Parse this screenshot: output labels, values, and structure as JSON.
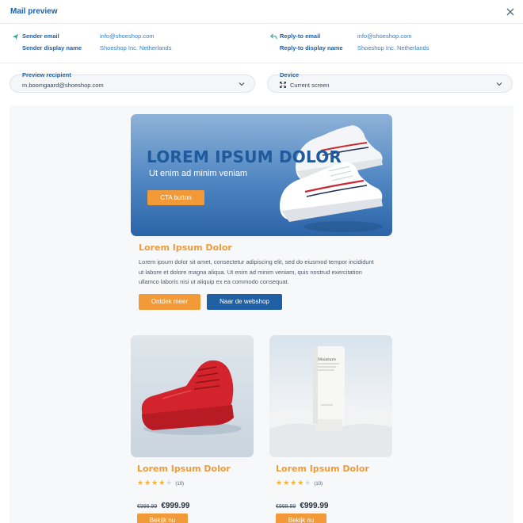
{
  "header": {
    "title": "Mail preview"
  },
  "sender": {
    "email_label": "Sender email",
    "email_value": "info@shoeshop.com",
    "name_label": "Sender display name",
    "name_value": "Shoeshop Inc. Netherlands"
  },
  "reply_to": {
    "email_label": "Reply-to email",
    "email_value": "info@shoeshop.com",
    "name_label": "Reply-to display name",
    "name_value": "Shoeshop Inc. Netherlands"
  },
  "preview_recipient": {
    "label": "Preview recipient",
    "value": "m.boomgaard@shoeshop.com"
  },
  "device": {
    "label": "Device",
    "value": "Current screen"
  },
  "email": {
    "hero": {
      "title": "LOREM IPSUM DOLOR",
      "subtitle": "Ut enim ad minim veniam",
      "cta": "CTA button"
    },
    "article": {
      "title": "Lorem Ipsum Dolor",
      "body": "Lorem ipsum dolor sit amet, consectetur adipiscing elit, sed do eiusmod tempor incididunt ut labore et dolore magna aliqua. Ut enim ad minim veniam, quis nostrud exercitation ullamco laboris nisi ut aliquip ex ea commodo consequat.",
      "primary_button": "Ontdek meer",
      "secondary_button": "Naar de webshop"
    },
    "products": [
      {
        "title": "Lorem Ipsum Dolor",
        "rating": 3.5,
        "reviews": "(10)",
        "old_price": "€999.99",
        "price": "€999.99",
        "button": "Bekijk nu"
      },
      {
        "title": "Lorem Ipsum Dolor",
        "rating": 3.5,
        "reviews": "(10)",
        "old_price": "€999.99",
        "price": "€999.99",
        "button": "Bekijk nu"
      }
    ]
  },
  "icons": {
    "close": "close-icon",
    "sender": "send-icon",
    "reply": "reply-icon",
    "chevron": "chevron-down-icon",
    "device": "expand-icon"
  },
  "colors": {
    "accent_orange": "#f29a38",
    "brand_blue": "#1f5fa3"
  }
}
